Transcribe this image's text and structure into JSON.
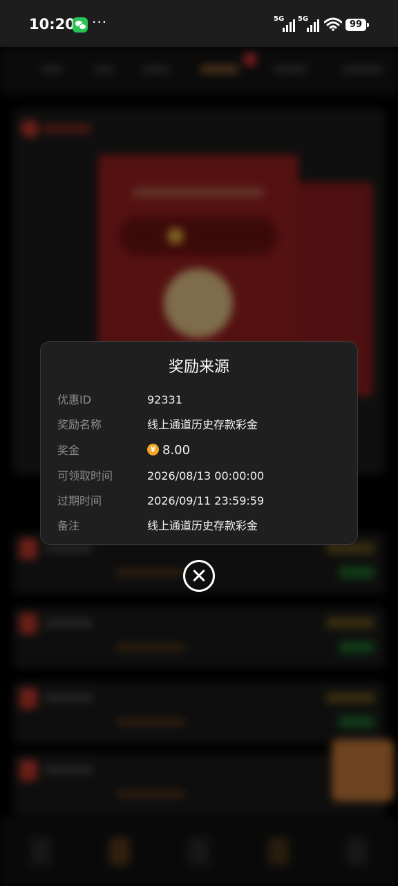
{
  "status_bar": {
    "time": "10:20",
    "more": "···",
    "signal_1_label": "5G",
    "signal_2_label": "5G",
    "battery": "99"
  },
  "modal": {
    "title": "奖励来源",
    "rows": [
      {
        "label": "优惠ID",
        "value": "92331"
      },
      {
        "label": "奖励名称",
        "value": "线上通道历史存款彩金"
      },
      {
        "label": "奖金",
        "value": "8.00",
        "icon": "yuan-coin-icon",
        "icon_glyph": "¥"
      },
      {
        "label": "可领取时间",
        "value": "2026/08/13 00:00:00"
      },
      {
        "label": "过期时间",
        "value": "2026/09/11 23:59:59"
      },
      {
        "label": "备注",
        "value": "线上通道历史存款彩金"
      }
    ]
  },
  "colors": {
    "modal_bg": "#1f1f1f",
    "label": "#8c8c8c",
    "value": "#f2f2f2",
    "coin": "#f2a623",
    "wechat": "#2bc356"
  },
  "icons": {
    "close": "close-circle-icon",
    "wechat": "wechat-icon",
    "wifi": "wifi-icon",
    "battery": "battery-icon"
  }
}
